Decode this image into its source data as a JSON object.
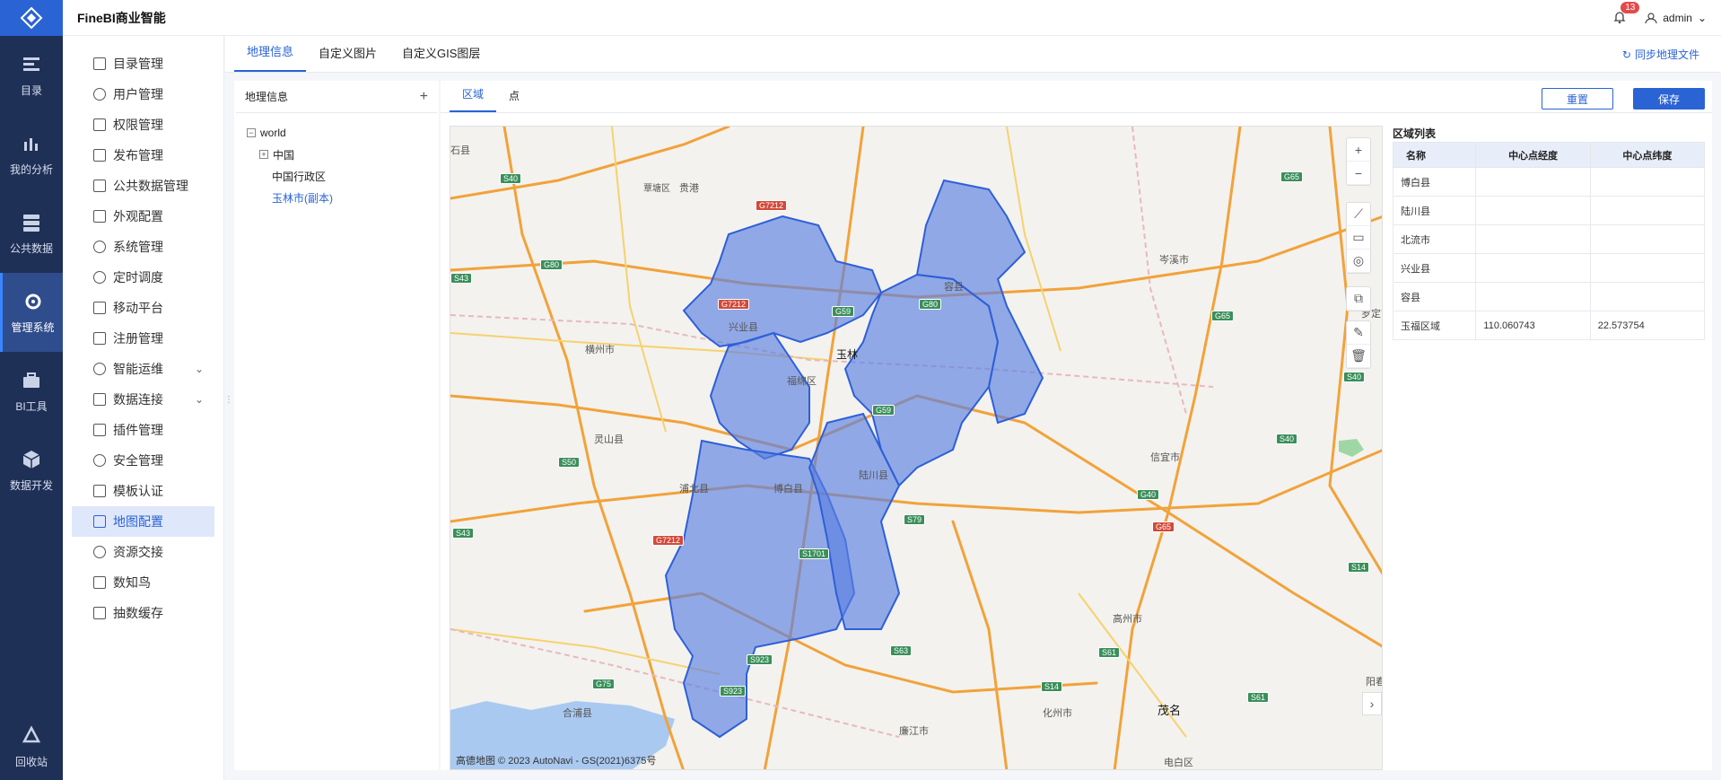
{
  "app": {
    "title": "FineBI商业智能"
  },
  "header": {
    "notifications": "13",
    "user": "admin"
  },
  "rail": {
    "items": [
      {
        "label": "目录",
        "icon": "catalog-icon"
      },
      {
        "label": "我的分析",
        "icon": "chart-icon"
      },
      {
        "label": "公共数据",
        "icon": "database-icon"
      },
      {
        "label": "管理系统",
        "icon": "gear-icon"
      },
      {
        "label": "BI工具",
        "icon": "toolbox-icon"
      },
      {
        "label": "数据开发",
        "icon": "cube-icon"
      }
    ],
    "bottom": {
      "label": "回收站",
      "icon": "recycle-icon"
    }
  },
  "menu": {
    "items": [
      "目录管理",
      "用户管理",
      "权限管理",
      "发布管理",
      "公共数据管理",
      "外观配置",
      "系统管理",
      "定时调度",
      "移动平台",
      "注册管理",
      "智能运维",
      "数据连接",
      "插件管理",
      "安全管理",
      "模板认证",
      "地图配置",
      "资源交接",
      "数知鸟",
      "抽数缓存"
    ]
  },
  "tabs": [
    "地理信息",
    "自定义图片",
    "自定义GIS图层"
  ],
  "sync_label": "同步地理文件",
  "geo": {
    "title": "地理信息",
    "tree": {
      "root": "world",
      "child": "中国",
      "leaf1": "中国行政区",
      "leaf2": "玉林市(副本)"
    }
  },
  "subtabs": [
    "区域",
    "点"
  ],
  "buttons": {
    "reset": "重置",
    "save": "保存"
  },
  "map": {
    "labels": {
      "guigang": "贵港",
      "tanxiang": "覃塘区",
      "hengzhou": "横州市",
      "xingye": "兴业县",
      "yulin": "玉林",
      "fumian": "福绵区",
      "rongxian": "容县",
      "lingshan": "灵山县",
      "pubei": "浦北县",
      "bobai": "博白县",
      "luchuan": "陆川县",
      "cenxi": "岑溪市",
      "xinyi": "信宜市",
      "gaozhou": "高州市",
      "huazhou": "化州市",
      "maoming": "茂名",
      "hepu": "合浦县",
      "lianjiang": "廉江市",
      "dianbai": "电白区",
      "yangchun": "阳春",
      "shanglin": "石县",
      "yaoding": "罗定市"
    },
    "shields": {
      "s40a": "S40",
      "g7212a": "G7212",
      "g80a": "G80",
      "s43a": "S43",
      "g7212b": "G7212",
      "g59a": "G59",
      "g80b": "G80",
      "g59b": "G59",
      "s50": "S50",
      "g7212c": "G7212",
      "s43b": "S43",
      "s1701": "S1701",
      "s79": "S79",
      "s923a": "S923",
      "s923b": "S923",
      "g75": "G75",
      "s63": "S63",
      "s14a": "S14",
      "s61a": "S61",
      "s61b": "S61",
      "g65a": "G65",
      "g65b": "G65",
      "g65c": "G65",
      "s40b": "S40",
      "g40": "G40",
      "s40c": "S40",
      "s14b": "S14"
    },
    "copyright": "高德地图 © 2023 AutoNavi - GS(2021)6375号"
  },
  "region_list": {
    "title": "区域列表",
    "columns": [
      "名称",
      "中心点经度",
      "中心点纬度"
    ],
    "rows": [
      {
        "name": "博白县",
        "lng": "",
        "lat": ""
      },
      {
        "name": "陆川县",
        "lng": "",
        "lat": ""
      },
      {
        "name": "北流市",
        "lng": "",
        "lat": ""
      },
      {
        "name": "兴业县",
        "lng": "",
        "lat": ""
      },
      {
        "name": "容县",
        "lng": "",
        "lat": ""
      },
      {
        "name": "玉福区域",
        "lng": "110.060743",
        "lat": "22.573754"
      }
    ]
  }
}
